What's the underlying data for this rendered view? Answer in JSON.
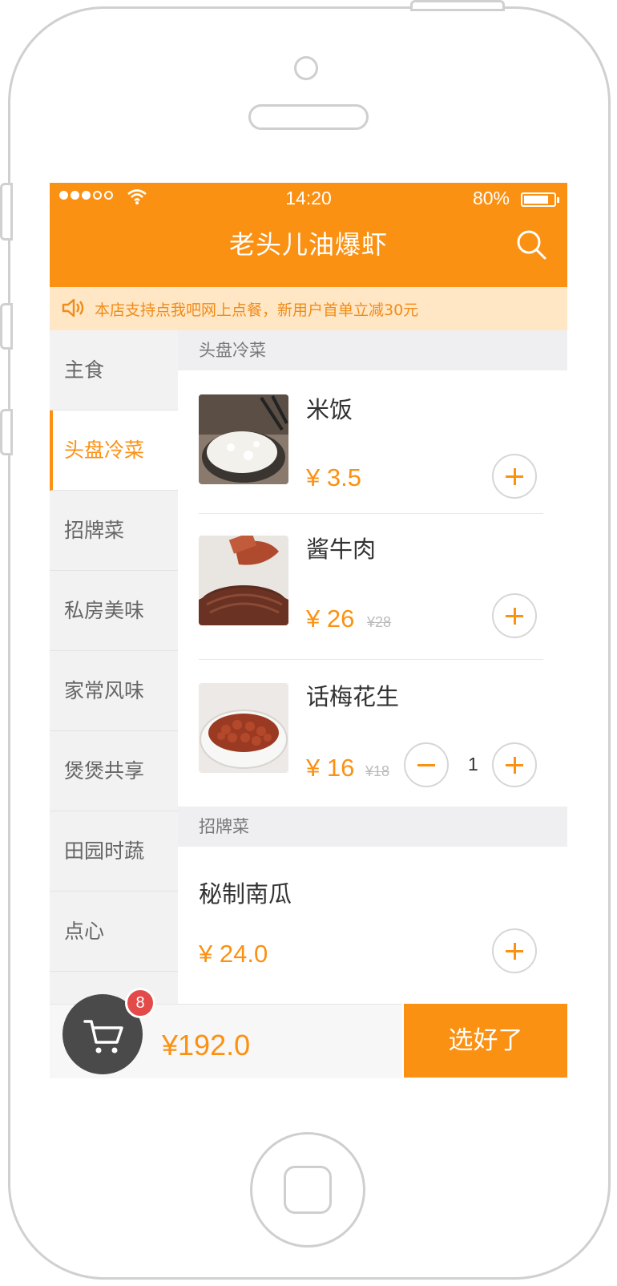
{
  "status_bar": {
    "time": "14:20",
    "battery": "80%"
  },
  "header": {
    "title": "老头儿油爆虾"
  },
  "notice": {
    "text": "本店支持点我吧网上点餐，新用户首单立减30元"
  },
  "sidebar": {
    "items": [
      {
        "label": "主食"
      },
      {
        "label": "头盘冷菜",
        "active": true
      },
      {
        "label": "招牌菜"
      },
      {
        "label": "私房美味"
      },
      {
        "label": "家常风味"
      },
      {
        "label": "煲煲共享"
      },
      {
        "label": "田园时蔬"
      },
      {
        "label": "点心"
      }
    ]
  },
  "sections": [
    {
      "title": "头盘冷菜",
      "dishes": [
        {
          "name": "米饭",
          "price": "¥ 3.5",
          "quantity": 0
        },
        {
          "name": "酱牛肉",
          "price": "¥ 26",
          "old_price": "¥28",
          "quantity": 0
        },
        {
          "name": "话梅花生",
          "price": "¥ 16",
          "old_price": "¥18",
          "quantity": "1"
        }
      ]
    },
    {
      "title": "招牌菜",
      "dishes": [
        {
          "name": "秘制南瓜",
          "price": "¥ 24.0",
          "quantity": 0
        }
      ]
    }
  ],
  "cart": {
    "badge_count": "8",
    "total": "¥192.0",
    "checkout_label": "选好了"
  },
  "colors": {
    "accent": "#fb9113",
    "notice_bg": "#ffe6c5",
    "badge": "#e34b4b"
  }
}
